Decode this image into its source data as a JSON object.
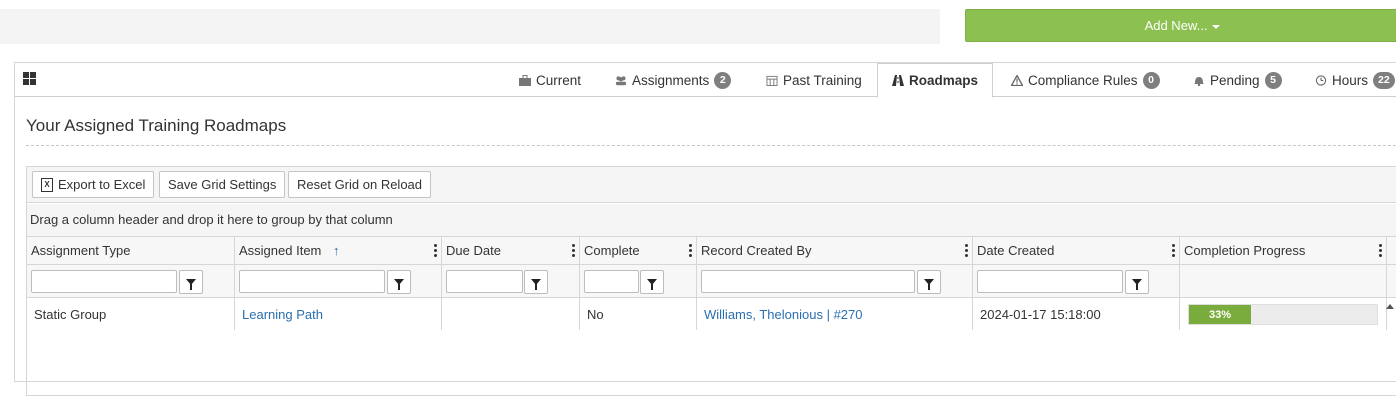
{
  "top": {
    "add_new_label": "Add New..."
  },
  "tabs": [
    {
      "label": "Current",
      "icon": "briefcase-icon",
      "badge": ""
    },
    {
      "label": "Assignments",
      "icon": "users-icon",
      "badge": "2"
    },
    {
      "label": "Past Training",
      "icon": "calendar-icon",
      "badge": ""
    },
    {
      "label": "Roadmaps",
      "icon": "road-icon",
      "badge": "",
      "active": true
    },
    {
      "label": "Compliance Rules",
      "icon": "warning-icon",
      "badge": "0"
    },
    {
      "label": "Pending",
      "icon": "bell-icon",
      "badge": "5"
    },
    {
      "label": "Hours",
      "icon": "clock-icon",
      "badge": "22"
    }
  ],
  "section": {
    "title": "Your Assigned Training Roadmaps"
  },
  "toolbar": {
    "export_label": "Export to Excel",
    "save_label": "Save Grid Settings",
    "reset_label": "Reset Grid on Reload"
  },
  "group_hint": "Drag a column header and drop it here to group by that column",
  "columns": [
    "Assignment Type",
    "Assigned Item",
    "Due Date",
    "Complete",
    "Record Created By",
    "Date Created",
    "Completion Progress"
  ],
  "sort_indicator": "↑",
  "rows": [
    {
      "assignment_type": "Static Group",
      "assigned_item": "Learning Path",
      "due_date": "",
      "complete": "No",
      "record_created_by": "Williams, Thelonious | #270",
      "date_created": "2024-01-17 15:18:00",
      "progress_label": "33%",
      "progress_value": 0.33
    }
  ],
  "colors": {
    "accent_green": "#8cc152",
    "progress_green": "#7aab3d",
    "link_blue": "#2a6fb0",
    "badge_gray": "#7f7f7f"
  }
}
